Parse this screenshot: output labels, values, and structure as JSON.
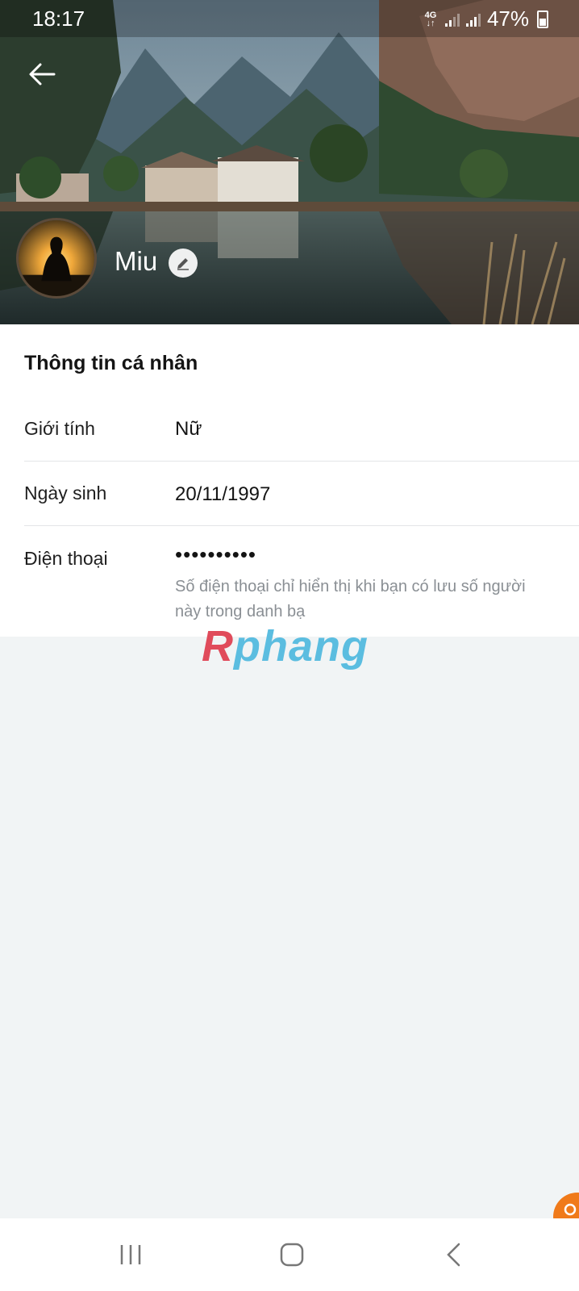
{
  "status_bar": {
    "time": "18:17",
    "network": "4G",
    "battery": "47%"
  },
  "profile": {
    "name": "Miu"
  },
  "personal_info": {
    "title": "Thông tin cá nhân",
    "gender": {
      "label": "Giới tính",
      "value": "Nữ"
    },
    "birthday": {
      "label": "Ngày sinh",
      "value": "20/11/1997"
    },
    "phone": {
      "label": "Điện thoại",
      "value": "••••••••••",
      "note": "Số điện thoại chỉ hiển thị khi bạn có lưu số người này trong danh bạ"
    }
  },
  "watermark": {
    "first": "R",
    "rest": "phang"
  },
  "icons": {
    "back": "back-arrow-icon",
    "edit": "pencil-icon",
    "recent": "recent-apps-icon",
    "home": "home-icon",
    "nav_back": "chevron-left-icon"
  },
  "colors": {
    "accent": "#f07a1a",
    "background": "#f1f4f5",
    "note_text": "#8a8f94"
  }
}
